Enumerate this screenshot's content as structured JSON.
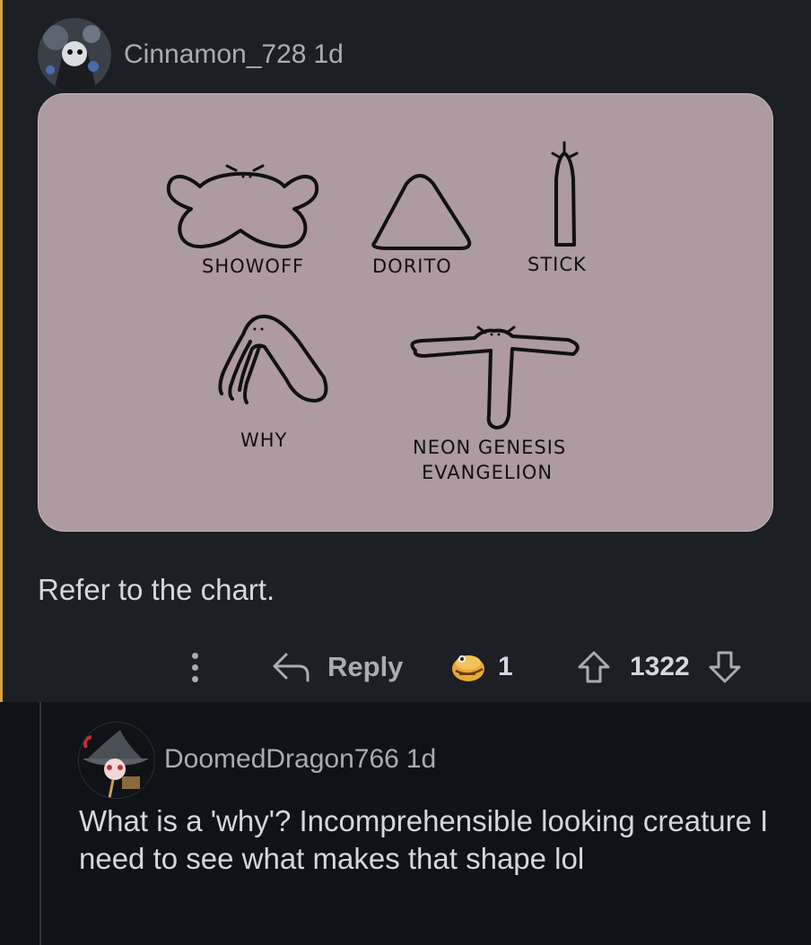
{
  "comment": {
    "username": "Cinnamon_728",
    "age": "1d",
    "body": "Refer to the chart.",
    "image_captions": {
      "showoff": "SHOWOFF",
      "dorito": "DORITO",
      "stick": "STICK",
      "why": "WHY",
      "neon_line1": "NEON GENESIS",
      "neon_line2": "EVANGELION"
    },
    "actions": {
      "reply_label": "Reply",
      "award_count": "1",
      "vote_count": "1322"
    }
  },
  "reply": {
    "username": "DoomedDragon766",
    "age": "1d",
    "body": "What is a 'why'? Incomprehensible looking creature I need to see what makes that shape lol"
  },
  "colors": {
    "highlight_bar": "#d8a23d",
    "card_background": "#ae9aa1",
    "comment_background": "#1c1f23",
    "page_background": "#0f1216"
  }
}
